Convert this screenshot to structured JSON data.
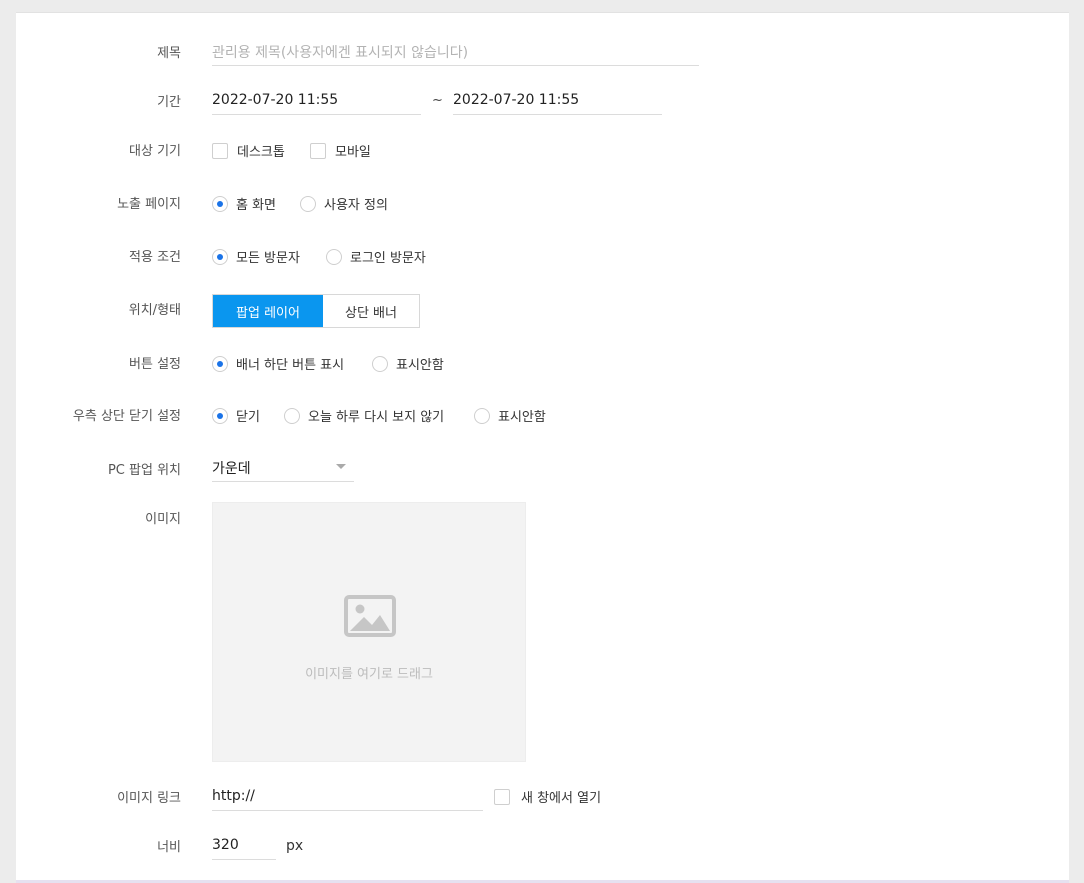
{
  "form": {
    "title": {
      "label": "제목",
      "placeholder": "관리용 제목(사용자에겐 표시되지 않습니다)"
    },
    "period": {
      "label": "기간",
      "start": "2022-07-20 11:55",
      "separator": "~",
      "end": "2022-07-20 11:55"
    },
    "device": {
      "label": "대상 기기",
      "options": [
        "데스크톱",
        "모바일"
      ]
    },
    "exposure_page": {
      "label": "노출 페이지",
      "options": [
        "홈 화면",
        "사용자 정의"
      ],
      "selected": 0
    },
    "condition": {
      "label": "적용 조건",
      "options": [
        "모든 방문자",
        "로그인 방문자"
      ],
      "selected": 0
    },
    "position_type": {
      "label": "위치/형태",
      "options": [
        "팝업 레이어",
        "상단 배너"
      ],
      "selected": 0
    },
    "button_setting": {
      "label": "버튼 설정",
      "options": [
        "배너 하단 버튼 표시",
        "표시안함"
      ],
      "selected": 0
    },
    "close_setting": {
      "label": "우측 상단 닫기 설정",
      "options": [
        "닫기",
        "오늘 하루 다시 보지 않기",
        "표시안함"
      ],
      "selected": 0
    },
    "pc_position": {
      "label": "PC 팝업 위치",
      "value": "가운데"
    },
    "image": {
      "label": "이미지",
      "drop_text": "이미지를 여기로 드래그",
      "icon": "image-placeholder-icon"
    },
    "image_link": {
      "label": "이미지 링크",
      "value": "http://",
      "new_window_label": "새 창에서 열기"
    },
    "width": {
      "label": "너비",
      "value": "320",
      "unit": "px"
    }
  },
  "colors": {
    "accent": "#0a96ef",
    "radio_dot": "#1a73e8",
    "background": "#ececec",
    "panel": "#ffffff"
  }
}
